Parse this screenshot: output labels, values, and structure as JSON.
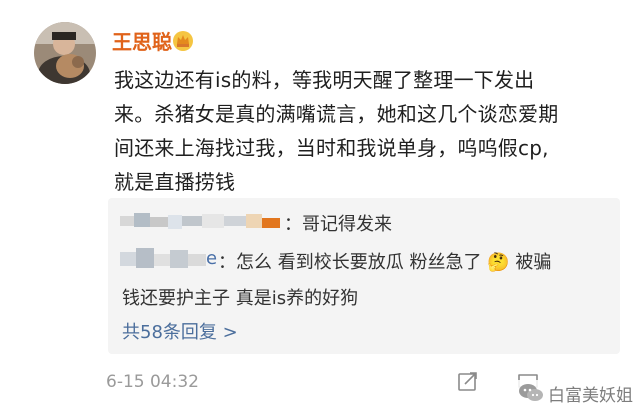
{
  "post": {
    "username": "王思聪",
    "lines": [
      "我这边还有is的料，等我明天醒了整理一下发出",
      "来。杀猪女是真的满嘴谎言，她和这几个谈恋爱期",
      "间还来上海找过我，当时和我说单身，呜呜假cp,",
      "就是直播捞钱"
    ]
  },
  "comments": [
    {
      "author_tail": "",
      "text": "：哥记得发来"
    },
    {
      "author_tail": "e",
      "text_before": "：怎么 看到校长要放瓜 粉丝急了",
      "emoji": "🤔",
      "text_after": " 被骗"
    },
    {
      "text": "钱还要护主子 真是is养的好狗"
    }
  ],
  "more_replies": "共58条回复 >",
  "timestamp": "6-15 04:32",
  "icons": {
    "avatar": "avatar-photo",
    "badge": "vip-crown-icon",
    "share": "share-icon",
    "comment": "comment-icon",
    "watermark": "wechat-logo-icon"
  },
  "watermark": {
    "text": "白富美妖姐"
  },
  "colors": {
    "username": "#e0631a",
    "link": "#4b6e9c",
    "comment_bg": "#f4f4f4",
    "meta": "#9a9a9a"
  }
}
